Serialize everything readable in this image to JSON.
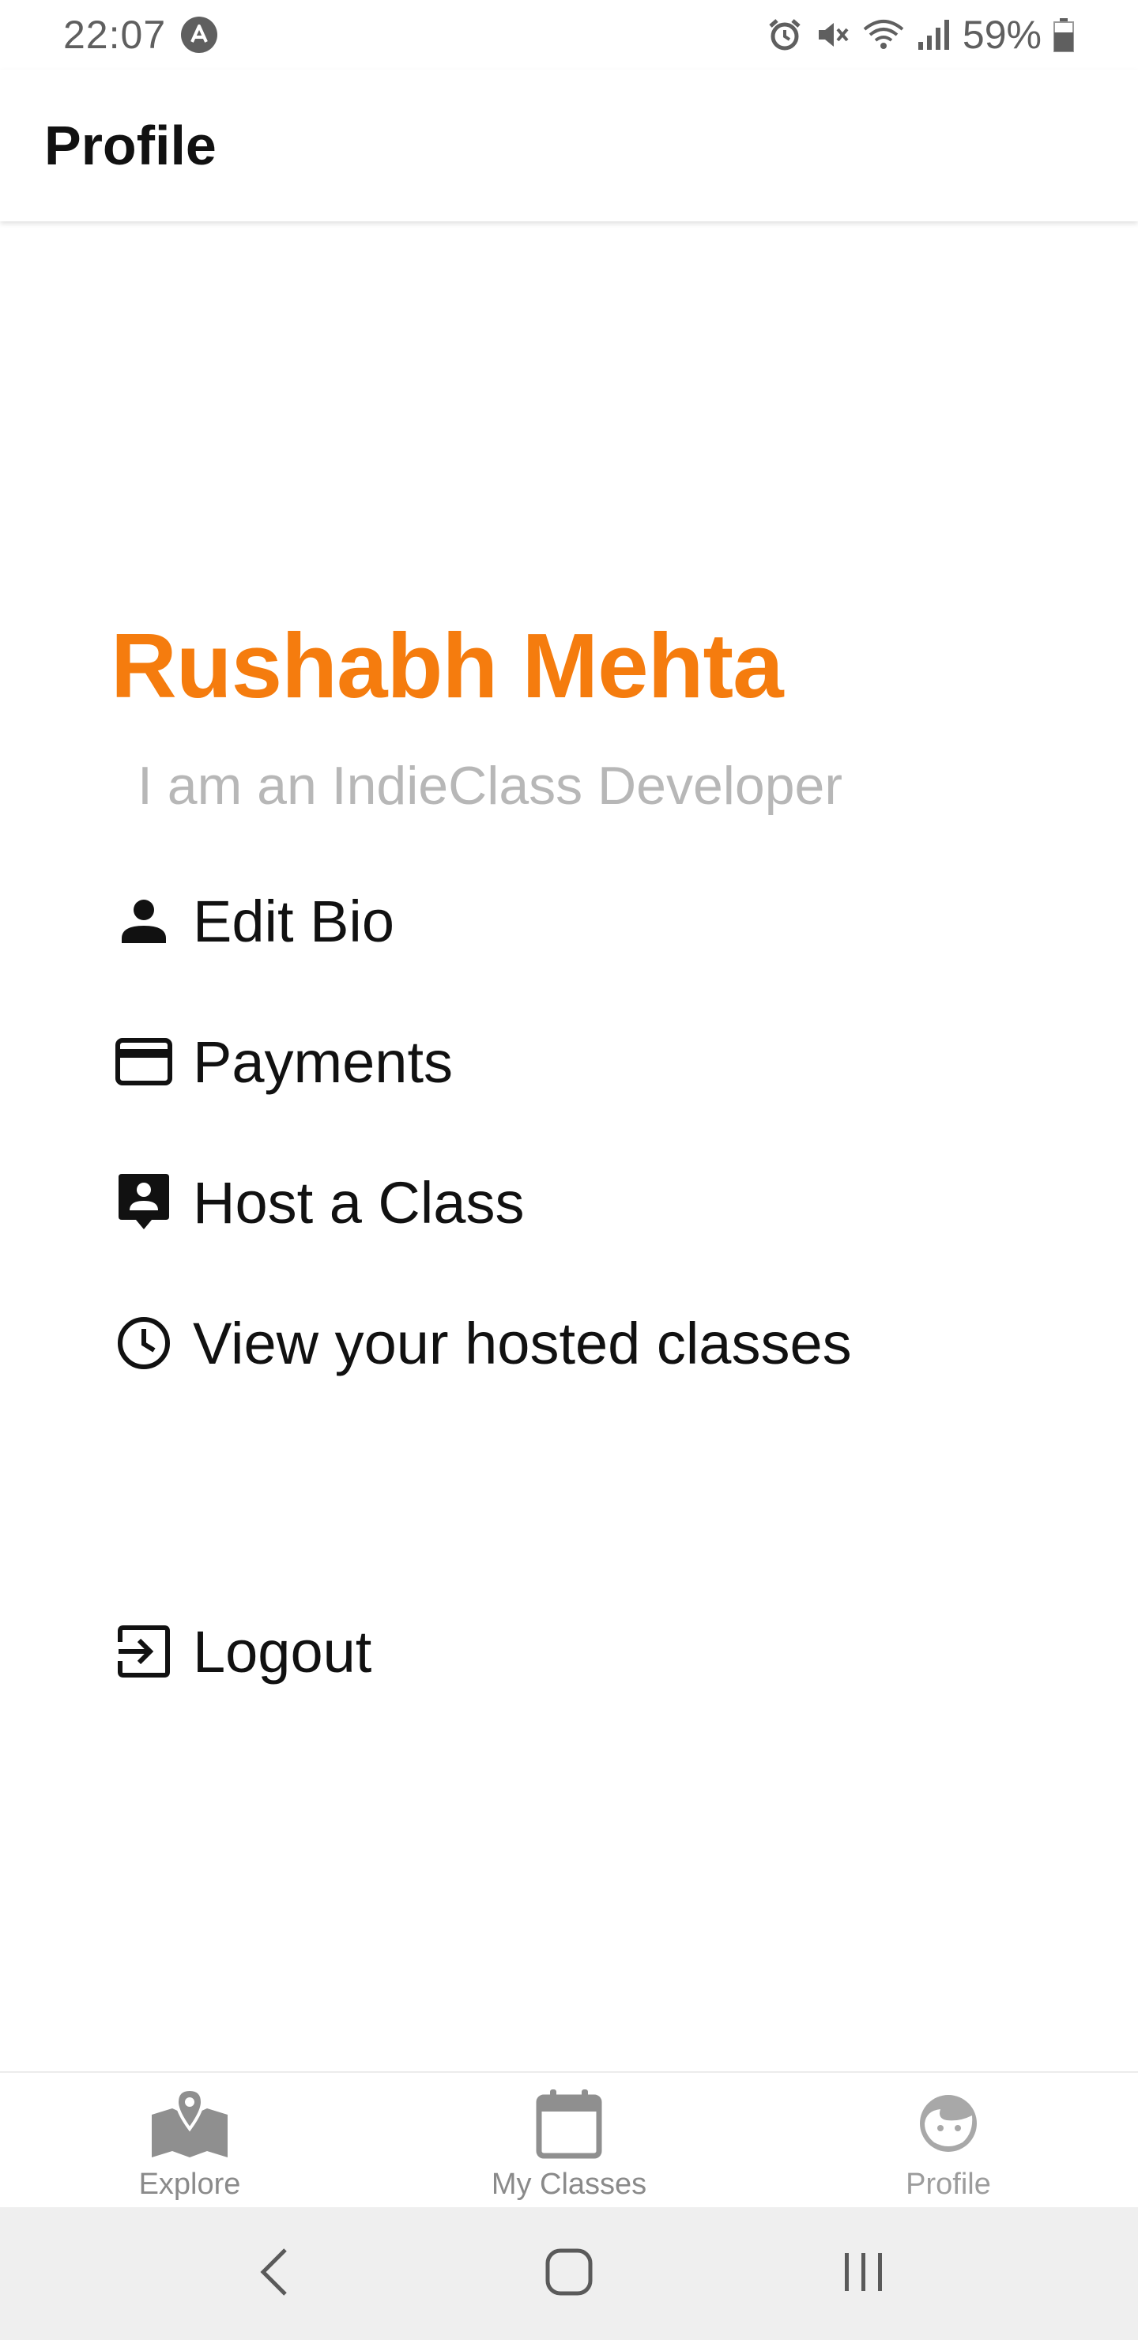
{
  "status_bar": {
    "time": "22:07",
    "battery_percent": "59%",
    "icons": [
      "app-notification-icon",
      "alarm-icon",
      "mute-icon",
      "wifi-icon",
      "signal-icon",
      "battery-icon"
    ]
  },
  "app_bar": {
    "title": "Profile"
  },
  "profile": {
    "name": "Rushabh Mehta",
    "bio": "I am an IndieClass Developer"
  },
  "menu": {
    "edit_bio": {
      "label": "Edit Bio",
      "icon": "person-icon"
    },
    "payments": {
      "label": "Payments",
      "icon": "credit-card-icon"
    },
    "host_class": {
      "label": "Host a Class",
      "icon": "contact-badge-icon"
    },
    "view_hosted": {
      "label": "View your hosted classes",
      "icon": "clock-icon"
    },
    "logout": {
      "label": "Logout",
      "icon": "exit-icon"
    }
  },
  "bottom_nav": {
    "explore": {
      "label": "Explore",
      "icon": "map-pin-icon"
    },
    "my_classes": {
      "label": "My Classes",
      "icon": "calendar-icon"
    },
    "profile": {
      "label": "Profile",
      "icon": "face-icon",
      "active": true
    }
  },
  "colors": {
    "accent": "#f57c0e",
    "bio_text": "#b7b7b7",
    "nav_icon": "#8f8f8f",
    "nav_icon_active": "#a8a8a8",
    "system_nav_bg": "#efefef"
  }
}
